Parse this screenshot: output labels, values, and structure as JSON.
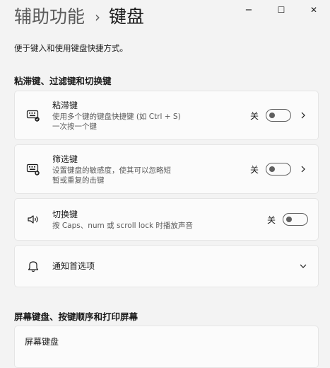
{
  "header": {
    "breadcrumb_parent": "辅助功能",
    "breadcrumb_separator": "›",
    "breadcrumb_current": "键盘"
  },
  "window_controls": {
    "minimize": "−",
    "maximize": "☐",
    "close": "✕"
  },
  "description": "便于键入和使用键盘快捷方式。",
  "section1": {
    "heading": "粘滞键、过滤键和切换键"
  },
  "sticky_keys": {
    "title": "粘滞键",
    "subtitle_line1": "使用多个键的键盘快捷键 (如 Ctrl + S)",
    "subtitle_line2": "一次按一个键",
    "toggle_label": "关",
    "icon": "keyboard-sticky-icon"
  },
  "filter_keys": {
    "title": "筛选键",
    "subtitle_line1": "设置键盘的敏感度，使其可以忽略短",
    "subtitle_line2": "暂或重复的击键",
    "toggle_label": "关",
    "icon": "keyboard-filter-icon"
  },
  "toggle_keys": {
    "title": "切换键",
    "subtitle_line1": "按 Caps、num 或 scroll lock 时播放声音",
    "toggle_label": "关",
    "icon": "speaker-icon"
  },
  "notification": {
    "title": "通知首选项",
    "icon": "bell-icon"
  },
  "section2": {
    "heading": "屏幕键盘、按键顺序和打印屏幕"
  },
  "onscreen_keyboard": {
    "title": "屏幕键盘"
  },
  "colors": {
    "background": "#f3f3f3",
    "card": "#fbfbfb",
    "toggle_off": "#5f5f5f"
  }
}
